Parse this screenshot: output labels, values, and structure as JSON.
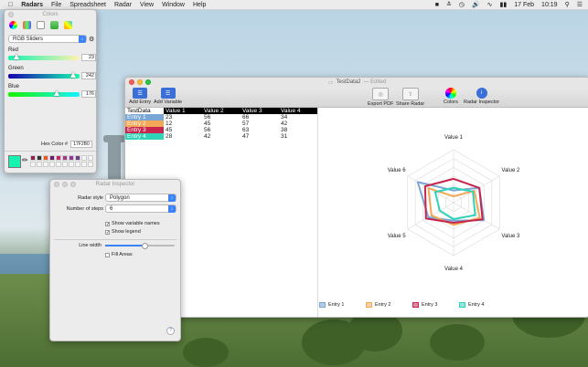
{
  "menubar": {
    "app": "Radars",
    "items": [
      "File",
      "Spreadsheet",
      "Radar",
      "View",
      "Window",
      "Help"
    ],
    "date": "17 Feb",
    "time": "10:19"
  },
  "colors_panel": {
    "title": "Colors",
    "mode": "RGB Sliders",
    "red_label": "Red",
    "red_value": "23",
    "red_level": 0.09,
    "green_label": "Green",
    "green_value": "242",
    "green_level": 0.95,
    "blue_label": "Blue",
    "blue_value": "176",
    "blue_level": 0.69,
    "hex_label": "Hex Color #",
    "hex_value": "17F2B0",
    "current_color": "#17f2b0",
    "swatches": [
      "#8b2252",
      "#333333",
      "#e85a1e",
      "#6a1b6a",
      "#c22a6a",
      "#a23a8a",
      "#8e3b95",
      "#6c3a8c",
      "#f5f5f5",
      "#f5f5f5"
    ]
  },
  "inspector": {
    "title": "Radar Inspector",
    "style_label": "Radar style",
    "style_value": "Polygon",
    "steps_label": "Number of steps",
    "steps_value": "6",
    "show_names": "Show variable names",
    "show_legend": "Show legend",
    "line_width_label": "Line width",
    "line_width": 0.55,
    "fill_areas": "Fill Areas",
    "help": "?"
  },
  "main": {
    "title": "TestData2",
    "edited": "— Edited",
    "toolbar": {
      "add_entry": "Add Entry",
      "add_variable": "Add Variable",
      "export_pdf": "Export PDF",
      "share": "Share Radar",
      "colors": "Colors",
      "inspector": "Radar Inspector"
    },
    "table": {
      "headers": [
        "TestData",
        "Value 1",
        "Value 2",
        "Value 3",
        "Value 4"
      ],
      "rows": [
        {
          "name": "Entry 1",
          "color": "#7aa6d6",
          "values": [
            "23",
            "56",
            "66",
            "34"
          ]
        },
        {
          "name": "Entry 2",
          "color": "#f3a857",
          "values": [
            "12",
            "45",
            "57",
            "42"
          ]
        },
        {
          "name": "Entry 3",
          "color": "#c7254e",
          "values": [
            "45",
            "56",
            "63",
            "38"
          ]
        },
        {
          "name": "Entry 4",
          "color": "#2fd3b7",
          "values": [
            "28",
            "42",
            "47",
            "31"
          ]
        }
      ]
    }
  },
  "chart_data": {
    "type": "radar",
    "axes": [
      "Value 1",
      "Value 2",
      "Value 3",
      "Value 4",
      "Value 5",
      "Value 6"
    ],
    "rmax": 100,
    "steps": 6,
    "series": [
      {
        "name": "Entry 1",
        "color": "#7aa6d6",
        "values": [
          23,
          56,
          66,
          34,
          55,
          78
        ]
      },
      {
        "name": "Entry 2",
        "color": "#f3a857",
        "values": [
          12,
          45,
          57,
          42,
          48,
          55
        ]
      },
      {
        "name": "Entry 3",
        "color": "#c7254e",
        "values": [
          45,
          56,
          63,
          38,
          60,
          62
        ]
      },
      {
        "name": "Entry 4",
        "color": "#2fd3b7",
        "values": [
          28,
          42,
          47,
          31,
          30,
          40
        ]
      }
    ]
  }
}
